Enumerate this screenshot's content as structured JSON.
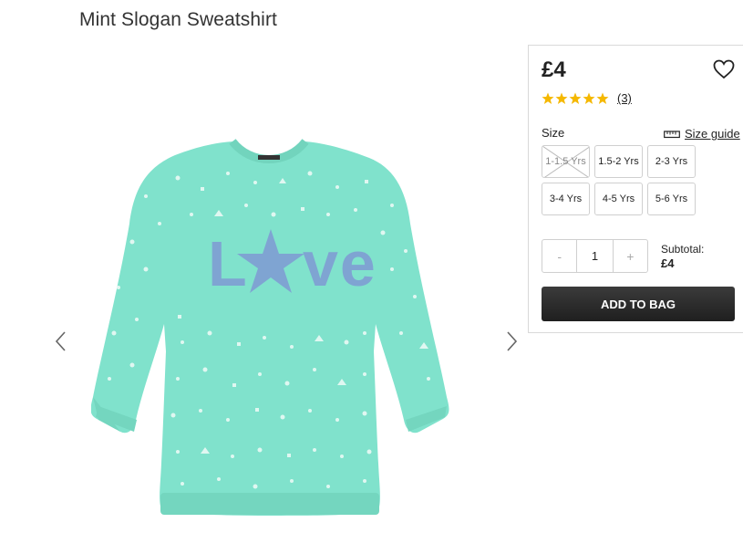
{
  "product": {
    "title": "Mint Slogan Sweatshirt",
    "image_alt": "Mint sweatshirt with LOVE star slogan",
    "slogan": "LOVE",
    "colors": {
      "mint": "#7fe3cc",
      "slogan": "#7fa4d2",
      "dots": "#e8faf5"
    }
  },
  "gallery": {
    "prev_icon": "chevron-left-icon",
    "next_icon": "chevron-right-icon"
  },
  "purchase": {
    "price": "£4",
    "wishlist_icon": "heart-icon",
    "rating": {
      "stars": 5,
      "count_label": "(3)",
      "star_color": "#f5b800"
    },
    "size_label": "Size",
    "size_guide_label": "Size guide",
    "sizes": [
      {
        "label": "1-1.5 Yrs",
        "available": false
      },
      {
        "label": "1.5-2 Yrs",
        "available": true
      },
      {
        "label": "2-3 Yrs",
        "available": true
      },
      {
        "label": "3-4 Yrs",
        "available": true
      },
      {
        "label": "4-5 Yrs",
        "available": true
      },
      {
        "label": "5-6 Yrs",
        "available": true
      }
    ],
    "quantity": {
      "minus": "-",
      "value": "1",
      "plus": "+"
    },
    "subtotal_label": "Subtotal:",
    "subtotal_value": "£4",
    "add_to_bag": "ADD TO BAG"
  }
}
